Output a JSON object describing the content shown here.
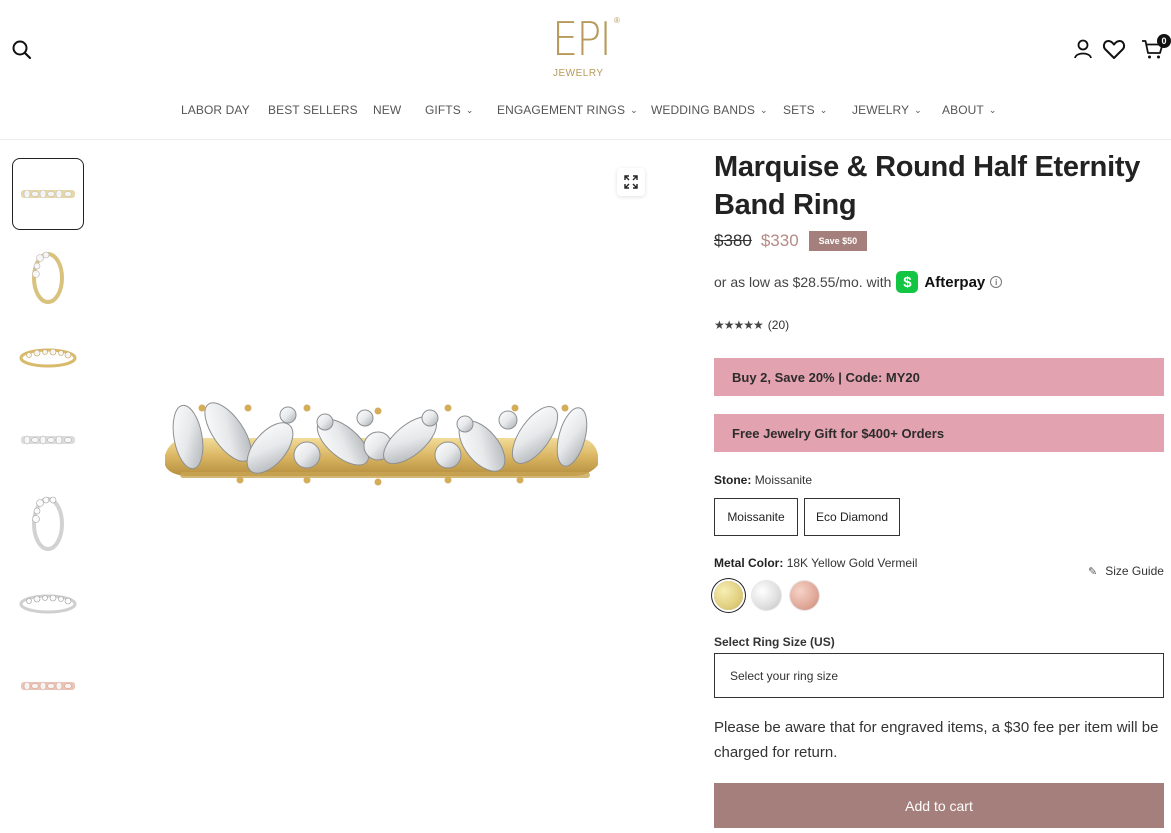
{
  "header": {
    "logo_text": "EPI",
    "logo_sub": "JEWELRY",
    "logo_mark": "®",
    "cart_count": "0",
    "icons": [
      "search-icon",
      "account-icon",
      "heart-icon",
      "cart-icon"
    ]
  },
  "nav": [
    {
      "label": "LABOR DAY",
      "has_dropdown": false
    },
    {
      "label": "BEST SELLERS",
      "has_dropdown": false
    },
    {
      "label": "NEW",
      "has_dropdown": false
    },
    {
      "label": "GIFTS",
      "has_dropdown": true
    },
    {
      "label": "ENGAGEMENT RINGS",
      "has_dropdown": true
    },
    {
      "label": "WEDDING BANDS",
      "has_dropdown": true
    },
    {
      "label": "SETS",
      "has_dropdown": true
    },
    {
      "label": "JEWELRY",
      "has_dropdown": true
    },
    {
      "label": "ABOUT",
      "has_dropdown": true
    }
  ],
  "product": {
    "title": "Marquise & Round Half Eternity Band Ring",
    "price_old": "$380",
    "price_new": "$330",
    "save_badge": "Save $50",
    "afterpay_text": "or as low as $28.55/mo. with",
    "afterpay_logo": "$",
    "afterpay_name": "Afterpay",
    "info_mark": "i",
    "stars": "★★★★★",
    "rating_count": "(20)",
    "promo1": "Buy 2, Save 20% | Code: MY20",
    "promo2": "Free Jewelry Gift for $400+ Orders",
    "stone_label": "Stone:",
    "stone_value": "Moissanite",
    "stone_options": [
      "Moissanite",
      "Eco Diamond"
    ],
    "metal_label": "Metal Color:",
    "metal_value": "18K Yellow Gold Vermeil",
    "metal_swatches": [
      "gold",
      "silver",
      "rose-gold"
    ],
    "size_guide": "Size Guide",
    "size_label": "Select Ring Size (US)",
    "size_placeholder": "Select your ring size",
    "notice": "Please be aware that for engraved items, a $30 fee per item will be charged for return.",
    "add_to_cart": "Add to cart"
  },
  "colors": {
    "brand_gold": "#b79a5a",
    "promo_pink": "#e3a2af",
    "button_mauve": "#a57f7b",
    "sale_price": "#b58a84"
  }
}
